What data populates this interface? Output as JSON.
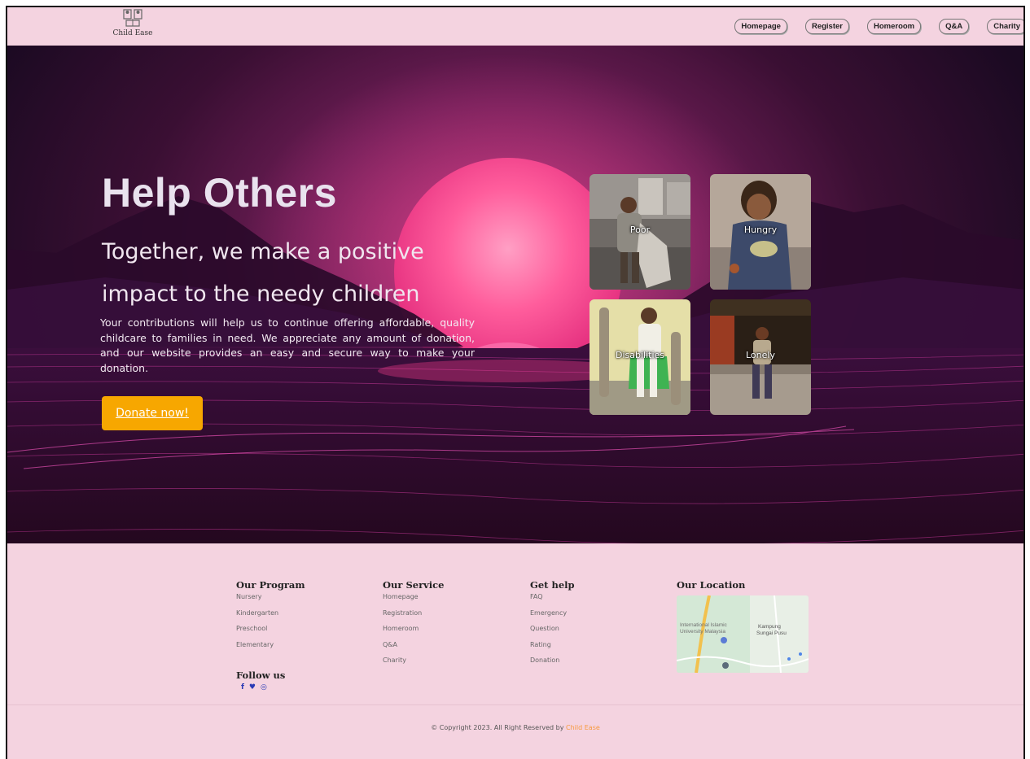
{
  "header": {
    "logo_text": "Child Ease",
    "nav": [
      "Homepage",
      "Register",
      "Homeroom",
      "Q&A",
      "Charity"
    ]
  },
  "hero": {
    "title": "Help Others",
    "subtitle": "Together, we make a positive impact to the needy children",
    "body": "Your contributions will help us to continue offering affordable, quality childcare to families in need. We appreciate any amount of donation, and our website provides an easy and secure way to make your donation.",
    "cta": "Donate now!",
    "cards": [
      "Poor",
      "Hungry",
      "Disabilities",
      "Lonely"
    ]
  },
  "footer": {
    "columns": [
      {
        "title": "Our Program",
        "items": [
          "Nursery",
          "Kindergarten",
          "Preschool",
          "Elementary"
        ]
      },
      {
        "title": "Our Service",
        "items": [
          "Homepage",
          "Registration",
          "Homeroom",
          "Q&A",
          "Charity"
        ]
      },
      {
        "title": "Get help",
        "items": [
          "FAQ",
          "Emergency",
          "Question",
          "Rating",
          "Donation"
        ]
      }
    ],
    "location_title": "Our Location",
    "map_labels": [
      "International Islamic",
      "University Malaysia",
      "Kampung",
      "Sungai Pusu"
    ],
    "follow_title": "Follow us",
    "social": [
      "facebook-icon",
      "twitter-icon",
      "instagram-icon"
    ],
    "copyright_prefix": "© Copyright 2023. All Right Reserved by",
    "copyright_brand": "Child Ease"
  },
  "colors": {
    "page_bg": "#f4d3e0",
    "donate": "#f7a700",
    "brand_link": "#f79a3e"
  }
}
